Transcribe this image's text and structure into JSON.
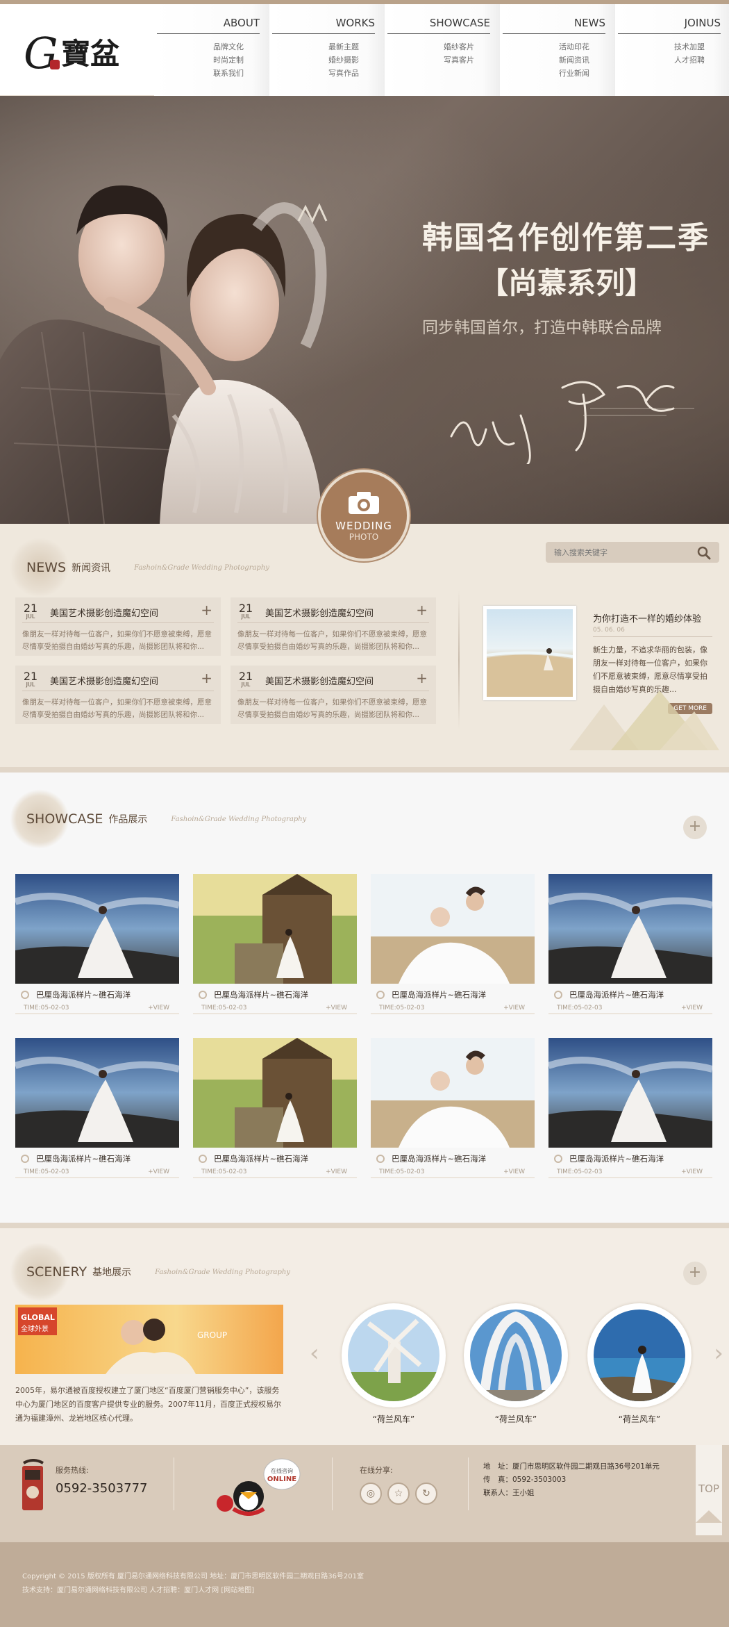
{
  "header": {
    "nav": [
      {
        "title": "ABOUT",
        "items": [
          "品牌文化",
          "时尚定制",
          "联系我们"
        ]
      },
      {
        "title": "WORKS",
        "items": [
          "最新主题",
          "婚纱摄影",
          "写真作品"
        ]
      },
      {
        "title": "SHOWCASE",
        "items": [
          "婚纱客片",
          "写真客片"
        ]
      },
      {
        "title": "NEWS",
        "items": [
          "活动印花",
          "新闻资讯",
          "行业新闻"
        ]
      },
      {
        "title": "JOINUS",
        "items": [
          "技术加盟",
          "人才招聘"
        ]
      }
    ]
  },
  "hero": {
    "headline": "韩国名作创作第二季",
    "series": "【尚慕系列】",
    "slogan": "同步韩国首尔，打造中韩联合品牌",
    "badge_top": "WEDDING",
    "badge_bottom": "PHOTO"
  },
  "news": {
    "en": "NEWS",
    "cn": "新闻资讯",
    "sub": "Fashoin&Grade Wedding Photography",
    "search_placeholder": "输入搜索关键字",
    "cards": [
      {
        "day": "21",
        "month": "JUL",
        "title": "美国艺术摄影创造魔幻空间",
        "text": "像朋友一样对待每一位客户，如果你们不愿意被束缚，愿意尽情享受拍摄自由婚纱写真的乐趣，尚摄影团队将和你..."
      },
      {
        "day": "21",
        "month": "JUL",
        "title": "美国艺术摄影创造魔幻空间",
        "text": "像朋友一样对待每一位客户，如果你们不愿意被束缚，愿意尽情享受拍摄自由婚纱写真的乐趣，尚摄影团队将和你..."
      },
      {
        "day": "21",
        "month": "JUL",
        "title": "美国艺术摄影创造魔幻空间",
        "text": "像朋友一样对待每一位客户，如果你们不愿意被束缚，愿意尽情享受拍摄自由婚纱写真的乐趣，尚摄影团队将和你..."
      },
      {
        "day": "21",
        "month": "JUL",
        "title": "美国艺术摄影创造魔幻空间",
        "text": "像朋友一样对待每一位客户，如果你们不愿意被束缚，愿意尽情享受拍摄自由婚纱写真的乐趣，尚摄影团队将和你..."
      }
    ],
    "feature": {
      "title": "为你打造不一样的婚纱体验",
      "date": "05. 06. 06",
      "text": "新生力量，不追求华丽的包装，像朋友一样对待每一位客户，如果你们不愿意被束缚，愿意尽情享受拍摄自由婚纱写真的乐趣...",
      "more": "GET MORE"
    }
  },
  "showcase": {
    "en": "SHOWCASE",
    "cn": "作品展示",
    "sub": "Fashoin&Grade Wedding Photography",
    "plus": "+",
    "items": [
      {
        "name": "巴厘岛海派样片~礁石海洋",
        "time": "TIME:05-02-03",
        "view": "+VIEW",
        "scene": "sea"
      },
      {
        "name": "巴厘岛海派样片~礁石海洋",
        "time": "TIME:05-02-03",
        "view": "+VIEW",
        "scene": "temple"
      },
      {
        "name": "巴厘岛海派样片~礁石海洋",
        "time": "TIME:05-02-03",
        "view": "+VIEW",
        "scene": "beach"
      },
      {
        "name": "巴厘岛海派样片~礁石海洋",
        "time": "TIME:05-02-03",
        "view": "+VIEW",
        "scene": "sea"
      },
      {
        "name": "巴厘岛海派样片~礁石海洋",
        "time": "TIME:05-02-03",
        "view": "+VIEW",
        "scene": "sea"
      },
      {
        "name": "巴厘岛海派样片~礁石海洋",
        "time": "TIME:05-02-03",
        "view": "+VIEW",
        "scene": "temple"
      },
      {
        "name": "巴厘岛海派样片~礁石海洋",
        "time": "TIME:05-02-03",
        "view": "+VIEW",
        "scene": "beach"
      },
      {
        "name": "巴厘岛海派样片~礁石海洋",
        "time": "TIME:05-02-03",
        "view": "+VIEW",
        "scene": "sea"
      }
    ]
  },
  "scenery": {
    "en": "SCENERY",
    "cn": "基地展示",
    "sub": "Fashoin&Grade Wedding Photography",
    "plus": "+",
    "banner_text": "GLOBAL",
    "banner_cn": "全球外景",
    "banner_group": "GROUP",
    "text": "2005年，易尔通被百度授权建立了厦门地区“百度厦门营销服务中心”，该服务中心为厦门地区的百度客户提供专业的服务。2007年11月，百度正式授权易尔通为福建漳州、龙岩地区核心代理。",
    "circles": [
      {
        "caption": "“荷兰风车”",
        "scene": "windmill"
      },
      {
        "caption": "“荷兰风车”",
        "scene": "arch"
      },
      {
        "caption": "“荷兰风车”",
        "scene": "bride"
      }
    ]
  },
  "footer": {
    "hotline_label": "服务热线:",
    "hotline": "0592-3503777",
    "online_label": "ONLINE",
    "online_sub": "在线咨询",
    "share_label": "在线分享:",
    "address_lines": [
      "地　址：厦门市思明区软件园二期观日路36号201单元",
      "传　真：0592-3503003",
      "联系人：王小姐"
    ],
    "top": "TOP",
    "copyright": "Copyright © 2015 版权所有 厦门易尔通网络科技有限公司 地址：厦门市思明区软件园二期观日路36号201室",
    "support": "技术支持：厦门易尔通网络科技有限公司 人才招聘：厦门人才网 [网站地图]"
  }
}
